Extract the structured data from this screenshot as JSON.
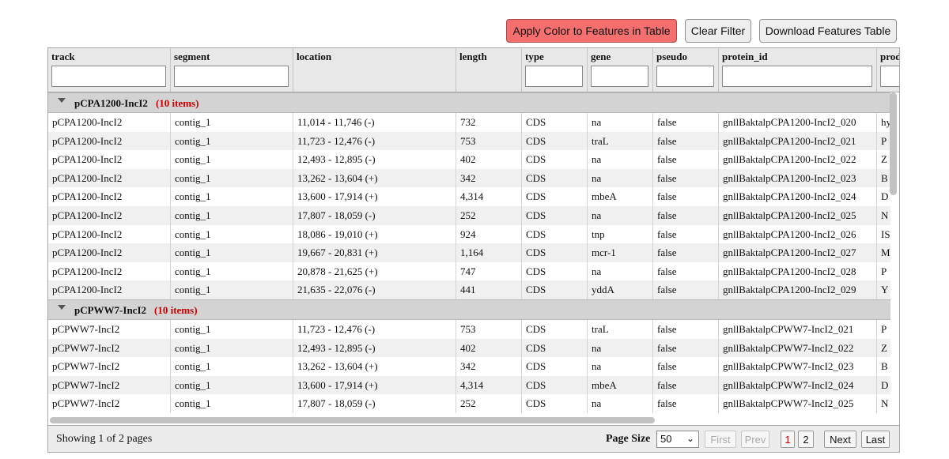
{
  "toolbar": {
    "apply_label": "Apply Color to Features in Table",
    "clear_label": "Clear Filter",
    "download_label": "Download Features Table",
    "apply_color": "#f56f6f"
  },
  "columns": [
    {
      "label": "track",
      "filter": ""
    },
    {
      "label": "segment",
      "filter": ""
    },
    {
      "label": "location"
    },
    {
      "label": "length"
    },
    {
      "label": "type",
      "filter": ""
    },
    {
      "label": "gene",
      "filter": ""
    },
    {
      "label": "pseudo",
      "filter": ""
    },
    {
      "label": "protein_id",
      "filter": ""
    },
    {
      "label": "product",
      "filter": ""
    }
  ],
  "groups": [
    {
      "name": "pCPA1200-IncI2",
      "count_label": "(10 items)",
      "rows": [
        [
          "pCPA1200-IncI2",
          "contig_1",
          "11,014 - 11,746 (-)",
          "732",
          "CDS",
          "na",
          "false",
          "gnllBaktalpCPA1200-IncI2_020",
          "hy"
        ],
        [
          "pCPA1200-IncI2",
          "contig_1",
          "11,723 - 12,476 (-)",
          "753",
          "CDS",
          "traL",
          "false",
          "gnllBaktalpCPA1200-IncI2_021",
          "P"
        ],
        [
          "pCPA1200-IncI2",
          "contig_1",
          "12,493 - 12,895 (-)",
          "402",
          "CDS",
          "na",
          "false",
          "gnllBaktalpCPA1200-IncI2_022",
          "Z"
        ],
        [
          "pCPA1200-IncI2",
          "contig_1",
          "13,262 - 13,604 (+)",
          "342",
          "CDS",
          "na",
          "false",
          "gnllBaktalpCPA1200-IncI2_023",
          "B"
        ],
        [
          "pCPA1200-IncI2",
          "contig_1",
          "13,600 - 17,914 (+)",
          "4,314",
          "CDS",
          "mbeA",
          "false",
          "gnllBaktalpCPA1200-IncI2_024",
          "D"
        ],
        [
          "pCPA1200-IncI2",
          "contig_1",
          "17,807 - 18,059 (-)",
          "252",
          "CDS",
          "na",
          "false",
          "gnllBaktalpCPA1200-IncI2_025",
          "N"
        ],
        [
          "pCPA1200-IncI2",
          "contig_1",
          "18,086 - 19,010 (+)",
          "924",
          "CDS",
          "tnp",
          "false",
          "gnllBaktalpCPA1200-IncI2_026",
          "IS"
        ],
        [
          "pCPA1200-IncI2",
          "contig_1",
          "19,667 - 20,831 (+)",
          "1,164",
          "CDS",
          "mcr-1",
          "false",
          "gnllBaktalpCPA1200-IncI2_027",
          "M"
        ],
        [
          "pCPA1200-IncI2",
          "contig_1",
          "20,878 - 21,625 (+)",
          "747",
          "CDS",
          "na",
          "false",
          "gnllBaktalpCPA1200-IncI2_028",
          "P"
        ],
        [
          "pCPA1200-IncI2",
          "contig_1",
          "21,635 - 22,076 (-)",
          "441",
          "CDS",
          "yddA",
          "false",
          "gnllBaktalpCPA1200-IncI2_029",
          "Y"
        ]
      ]
    },
    {
      "name": "pCPWW7-IncI2",
      "count_label": "(10 items)",
      "rows": [
        [
          "pCPWW7-IncI2",
          "contig_1",
          "11,723 - 12,476 (-)",
          "753",
          "CDS",
          "traL",
          "false",
          "gnllBaktalpCPWW7-IncI2_021",
          "P"
        ],
        [
          "pCPWW7-IncI2",
          "contig_1",
          "12,493 - 12,895 (-)",
          "402",
          "CDS",
          "na",
          "false",
          "gnllBaktalpCPWW7-IncI2_022",
          "Z"
        ],
        [
          "pCPWW7-IncI2",
          "contig_1",
          "13,262 - 13,604 (+)",
          "342",
          "CDS",
          "na",
          "false",
          "gnllBaktalpCPWW7-IncI2_023",
          "B"
        ],
        [
          "pCPWW7-IncI2",
          "contig_1",
          "13,600 - 17,914 (+)",
          "4,314",
          "CDS",
          "mbeA",
          "false",
          "gnllBaktalpCPWW7-IncI2_024",
          "D"
        ],
        [
          "pCPWW7-IncI2",
          "contig_1",
          "17,807 - 18,059 (-)",
          "252",
          "CDS",
          "na",
          "false",
          "gnllBaktalpCPWW7-IncI2_025",
          "N"
        ]
      ]
    }
  ],
  "pager": {
    "showing": "Showing 1 of 2 pages",
    "page_size_label": "Page Size",
    "page_size": "50",
    "first": "First",
    "prev": "Prev",
    "pages": [
      "1",
      "2"
    ],
    "current_page": "1",
    "next": "Next",
    "last": "Last"
  },
  "icons": {
    "group_toggle": "caret-down-icon",
    "page_size": "chevron-down-icon"
  }
}
